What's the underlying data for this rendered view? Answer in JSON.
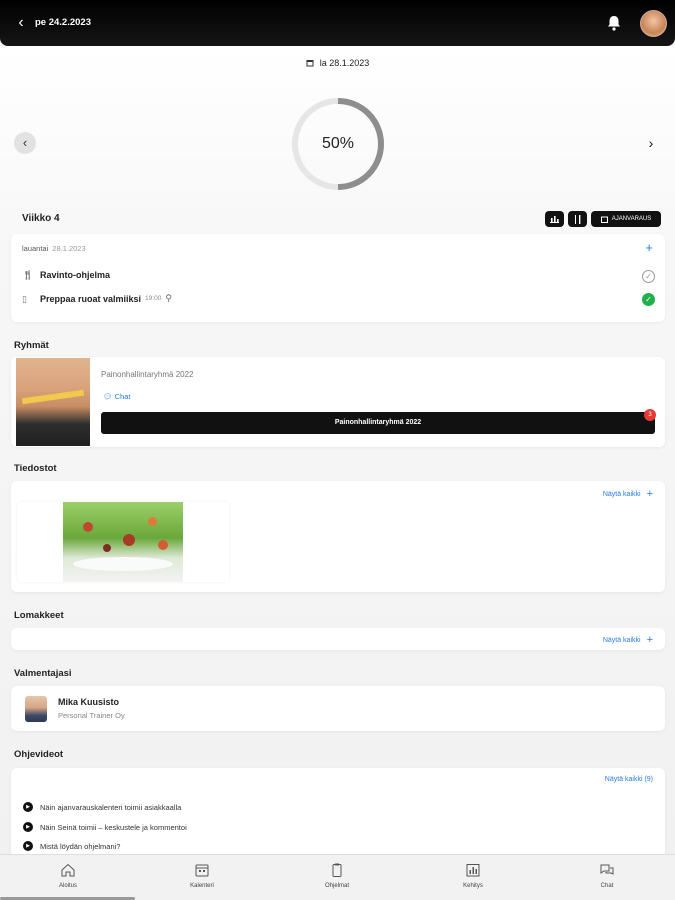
{
  "header": {
    "title": "pe 24.2.2023"
  },
  "progress": {
    "date": "la 28.1.2023",
    "percent_label": "50%",
    "percent": 50
  },
  "week": {
    "label": "Viikko 4",
    "tools": [
      "chart-icon",
      "fork-knife-icon"
    ],
    "schedule_label": "AJANVARAUS"
  },
  "day": {
    "weekday": "lauantai",
    "date": "28.1.2023",
    "tasks": [
      {
        "label": "Ravinto-ohjelma",
        "time": "",
        "done": false
      },
      {
        "label": "Preppaa ruoat valmiiksi",
        "time": "19:00",
        "done": true
      }
    ]
  },
  "groups": {
    "title": "Ryhmät",
    "name": "Painonhallintaryhmä 2022",
    "chat_label": "Chat",
    "button_label": "Painonhallintaryhmä 2022",
    "badge": "3"
  },
  "files": {
    "title": "Tiedostot",
    "show_all": "Näytä kaikki"
  },
  "forms": {
    "title": "Lomakkeet",
    "show_all": "Näytä kaikki"
  },
  "coaches": {
    "title": "Valmentajasi",
    "name": "Mika Kuusisto",
    "company": "Personal Trainer Oy"
  },
  "videos": {
    "title": "Ohjevideot",
    "show_all": "Näytä kaikki (9)",
    "items": [
      "Näin ajanvarauskalenteri toimii asiakkaalla",
      "Näin Seinä toimii – keskustele ja kommentoi",
      "Mistä löydän ohjelmani?"
    ]
  },
  "tabs": [
    "Aloitus",
    "Kalenteri",
    "Ohjelmat",
    "Kehitys",
    "Chat"
  ],
  "colors": {
    "accent": "#2a7be4",
    "success": "#20b14c",
    "badge": "#e53935"
  }
}
